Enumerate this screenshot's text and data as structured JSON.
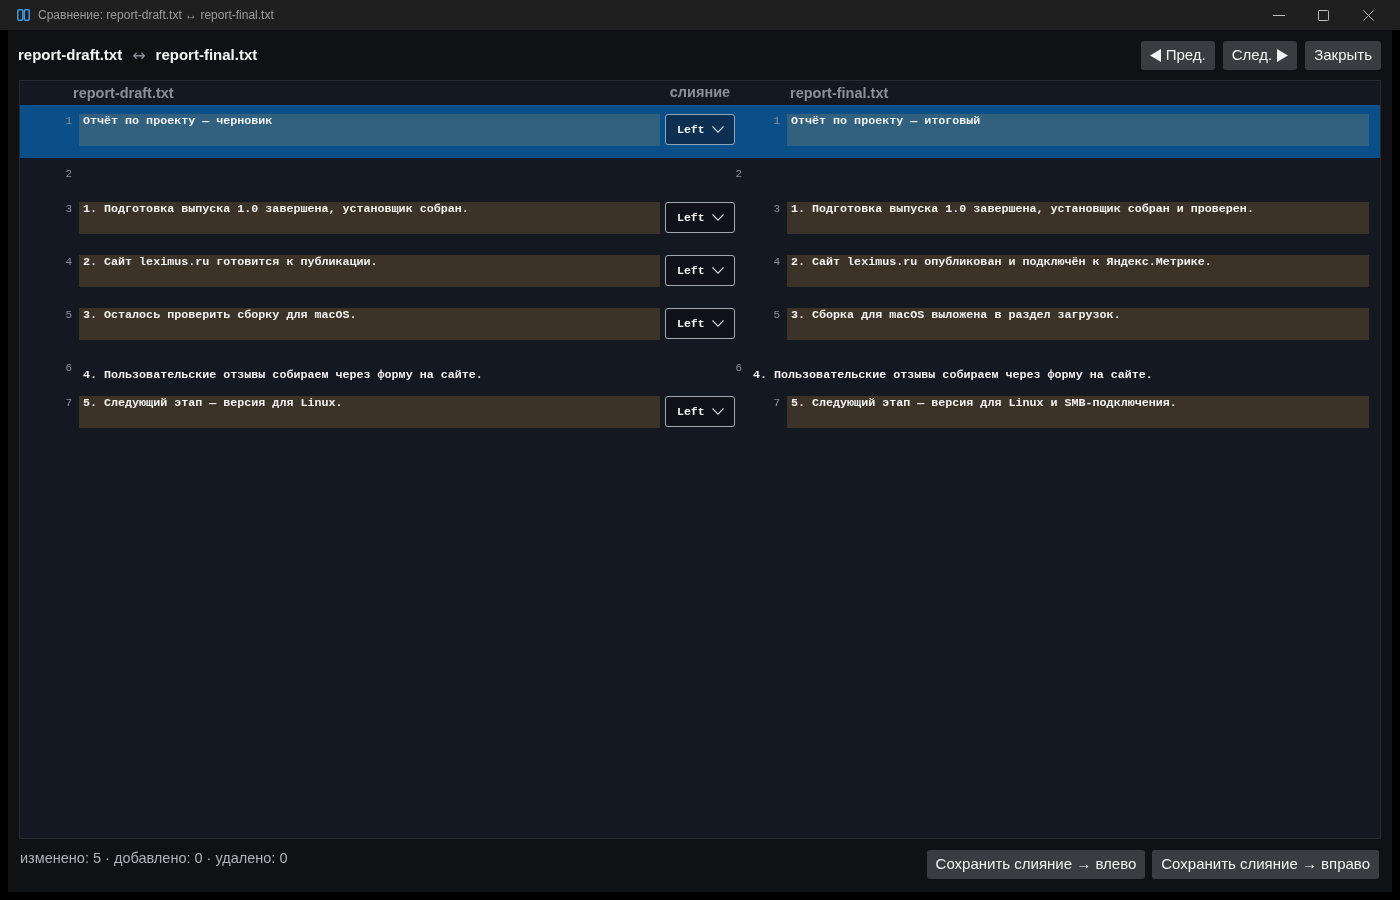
{
  "window": {
    "title": "Сравнение: report-draft.txt ↔ report-final.txt"
  },
  "header": {
    "left_file": "report-draft.txt",
    "separator": "↔",
    "right_file": "report-final.txt"
  },
  "nav_buttons": {
    "prev": {
      "label": "Пред."
    },
    "next": {
      "label": "След."
    },
    "close": {
      "label": "Закрыть"
    }
  },
  "diff": {
    "columns": {
      "left": "report-draft.txt",
      "merge": "слияние",
      "right": "report-final.txt"
    },
    "rows": [
      {
        "kind": "changed",
        "selected": true,
        "left": {
          "number": "1",
          "text": "Отчёт по проекту — черновик"
        },
        "merge": "Left",
        "right": {
          "number": "1",
          "text": "Отчёт по проекту — итоговый"
        }
      },
      {
        "kind": "same",
        "selected": false,
        "left": {
          "number": "2"
        },
        "right": {
          "number": "2"
        }
      },
      {
        "kind": "changed",
        "selected": false,
        "left": {
          "number": "3",
          "text": "1. Подготовка выпуска 1.0 завершена, установщик собран."
        },
        "merge": "Left",
        "right": {
          "number": "3",
          "text": "1. Подготовка выпуска 1.0 завершена, установщик собран и проверен."
        }
      },
      {
        "kind": "changed",
        "selected": false,
        "left": {
          "number": "4",
          "text": "2. Сайт leximus.ru готовится к публикации."
        },
        "merge": "Left",
        "right": {
          "number": "4",
          "text": "2. Сайт leximus.ru опубликован и подключён к Яндекс.Метрике."
        }
      },
      {
        "kind": "changed",
        "selected": false,
        "left": {
          "number": "5",
          "text": "3. Осталось проверить сборку для macOS."
        },
        "merge": "Left",
        "right": {
          "number": "5",
          "text": "3. Сборка для macOS выложена в раздел загрузок."
        }
      },
      {
        "kind": "same",
        "selected": false,
        "left": {
          "number": "6",
          "text": "4. Пользовательские отзывы собираем через форму на сайте."
        },
        "right": {
          "number": "6",
          "text": "4. Пользовательские отзывы собираем через форму на сайте."
        }
      },
      {
        "kind": "changed",
        "selected": false,
        "left": {
          "number": "7",
          "text": "5. Следующий этап — версия для Linux."
        },
        "merge": "Left",
        "right": {
          "number": "7",
          "text": "5. Следующий этап — версия для Linux и SMB-подключения."
        }
      }
    ]
  },
  "status_bar": {
    "summary": "изменено: 5 · добавлено: 0 · удалено: 0",
    "buttons": [
      "Сохранить слияние → влево",
      "Сохранить слияние → вправо"
    ]
  }
}
